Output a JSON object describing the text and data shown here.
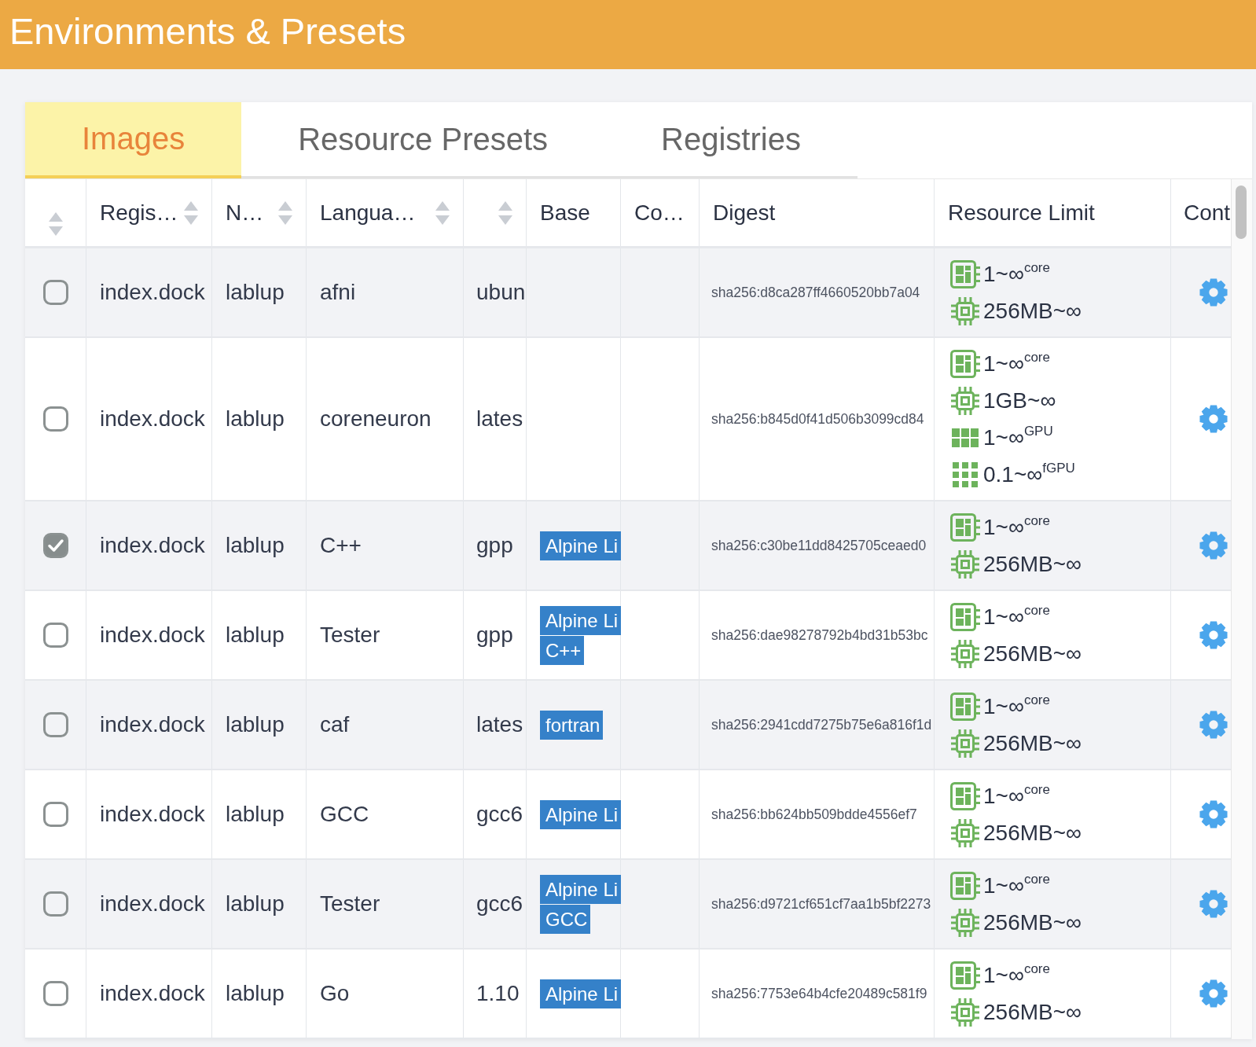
{
  "header": {
    "title": "Environments & Presets"
  },
  "tabs": [
    {
      "label": "Images",
      "selected": true
    },
    {
      "label": "Resource Presets",
      "selected": false
    },
    {
      "label": "Registries",
      "selected": false
    }
  ],
  "table": {
    "columns": [
      {
        "sortable": true
      },
      {
        "label": "Regis…",
        "sortable": true
      },
      {
        "label": "N…",
        "sortable": true
      },
      {
        "label": "Langua…",
        "sortable": true
      },
      {
        "sortable": true
      },
      {
        "label": "Base",
        "sortable": false
      },
      {
        "label": "Co…",
        "sortable": false
      },
      {
        "label": "Digest",
        "sortable": false
      },
      {
        "label": "Resource Limit",
        "sortable": false
      },
      {
        "label": "Cont",
        "sortable": false
      }
    ],
    "rows": [
      {
        "selected": false,
        "registry": "index.dock",
        "namespace": "lablup",
        "language": "afni",
        "version": "ubun",
        "digest": "sha256:d8ca287ff4660520bb7a04",
        "resources": [
          {
            "kind": "cpu",
            "text": "1~∞$^{core}$"
          },
          {
            "kind": "memory",
            "text": "256MB~∞"
          }
        ]
      },
      {
        "selected": false,
        "registry": "index.dock",
        "namespace": "lablup",
        "language": "coreneuron",
        "version": "lates",
        "digest": "sha256:b845d0f41d506b3099cd84",
        "resources": [
          {
            "kind": "cpu",
            "text": "1~∞$^{core}$"
          },
          {
            "kind": "memory",
            "text": "1GB~∞"
          },
          {
            "kind": "gpu",
            "text": "1~∞$^{GPU}$"
          },
          {
            "kind": "fgpu",
            "text": "0.1~∞$^{fGPU}$"
          }
        ]
      },
      {
        "selected": true,
        "registry": "index.dock",
        "namespace": "lablup",
        "language": "C++",
        "version": "gpp",
        "base": [
          {
            "label": "Alpine Li"
          }
        ],
        "digest": "sha256:c30be11dd8425705ceaed0",
        "resources": [
          {
            "kind": "cpu",
            "text": "1~∞$^{core}$"
          },
          {
            "kind": "memory",
            "text": "256MB~∞"
          }
        ]
      },
      {
        "selected": false,
        "registry": "index.dock",
        "namespace": "lablup",
        "language": "Tester",
        "version": "gpp",
        "base": [
          {
            "label": "Alpine Li"
          },
          {
            "label": "C++"
          }
        ],
        "digest": "sha256:dae98278792b4bd31b53bc",
        "resources": [
          {
            "kind": "cpu",
            "text": "1~∞$^{core}$"
          },
          {
            "kind": "memory",
            "text": "256MB~∞"
          }
        ]
      },
      {
        "selected": false,
        "registry": "index.dock",
        "namespace": "lablup",
        "language": "caf",
        "version": "lates",
        "base": [
          {
            "label": "fortran"
          }
        ],
        "digest": "sha256:2941cdd7275b75e6a816f1d",
        "resources": [
          {
            "kind": "cpu",
            "text": "1~∞$^{core}$"
          },
          {
            "kind": "memory",
            "text": "256MB~∞"
          }
        ]
      },
      {
        "selected": false,
        "registry": "index.dock",
        "namespace": "lablup",
        "language": "GCC",
        "version": "gcc6",
        "base": [
          {
            "label": "Alpine Li"
          }
        ],
        "digest": "sha256:bb624bb509bdde4556ef7",
        "resources": [
          {
            "kind": "cpu",
            "text": "1~∞$^{core}$"
          },
          {
            "kind": "memory",
            "text": "256MB~∞"
          }
        ]
      },
      {
        "selected": false,
        "registry": "index.dock",
        "namespace": "lablup",
        "language": "Tester",
        "version": "gcc6",
        "base": [
          {
            "label": "Alpine Li"
          },
          {
            "label": "GCC"
          }
        ],
        "digest": "sha256:d9721cf651cf7aa1b5bf2273",
        "resources": [
          {
            "kind": "cpu",
            "text": "1~∞$^{core}$"
          },
          {
            "kind": "memory",
            "text": "256MB~∞"
          }
        ]
      },
      {
        "selected": false,
        "registry": "index.dock",
        "namespace": "lablup",
        "language": "Go",
        "version": "1.10",
        "base": [
          {
            "label": "Alpine Li"
          }
        ],
        "digest": "sha256:7753e64b4cfe20489c581f9",
        "resources": [
          {
            "kind": "cpu",
            "text": "1~∞$^{core}$"
          },
          {
            "kind": "memory",
            "text": "256MB~∞"
          }
        ]
      }
    ]
  }
}
